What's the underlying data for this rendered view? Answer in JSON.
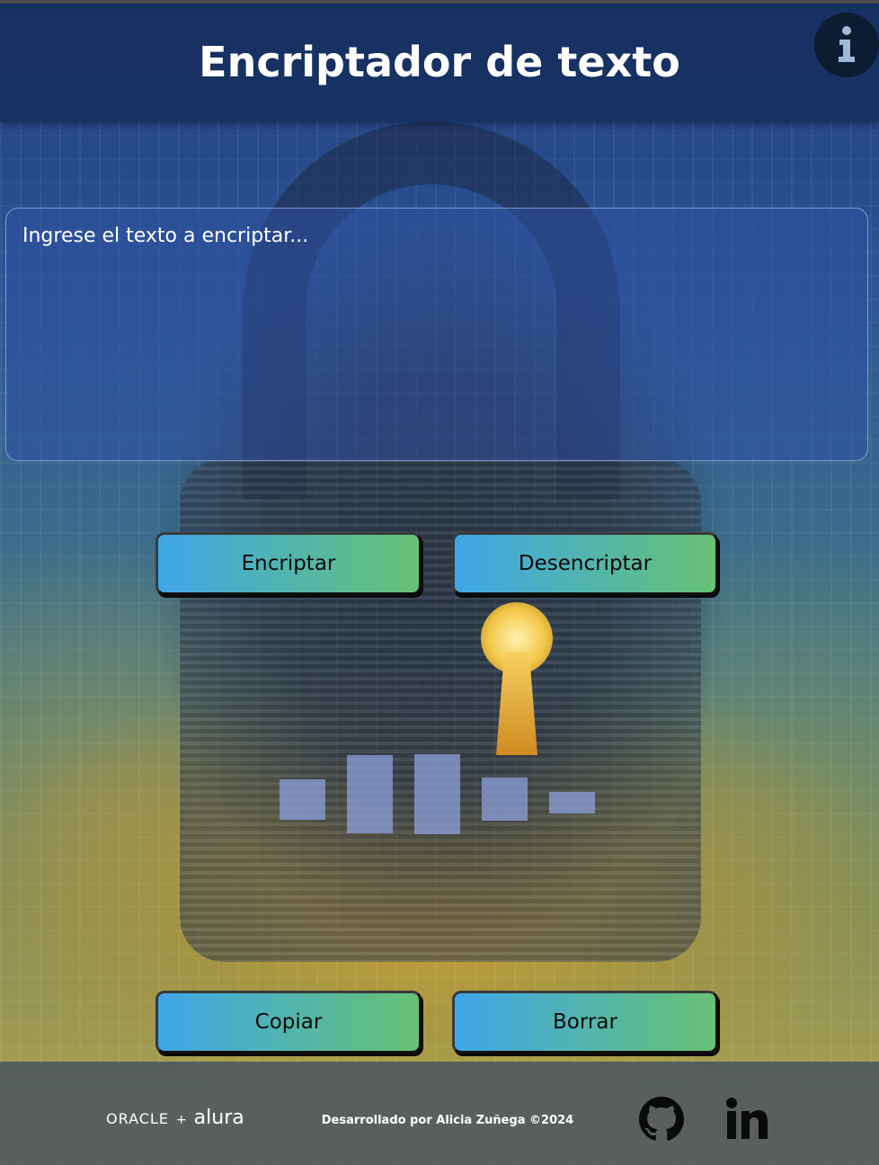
{
  "header": {
    "title": "Encriptador de texto",
    "info_icon": "info-icon"
  },
  "input": {
    "placeholder": "Ingrese el texto a encriptar..."
  },
  "actions": {
    "encrypt_label": "Encriptar",
    "decrypt_label": "Desencriptar"
  },
  "output_actions": {
    "copy_label": "Copiar",
    "clear_label": "Borrar"
  },
  "loader": {
    "bars": 5
  },
  "footer": {
    "brand_oracle": "ORACLE",
    "brand_plus": "+",
    "brand_alura": "alura",
    "credit": "Desarrollado por Alicia Zuñega ©2024",
    "social": [
      "github-icon",
      "linkedin-icon"
    ]
  },
  "colors": {
    "header_bg": "#163060",
    "button_gradient_start": "#3ea6e8",
    "button_gradient_end": "#67c274",
    "footer_bg": "#46505f",
    "loader_bar": "#8ca0dc"
  }
}
